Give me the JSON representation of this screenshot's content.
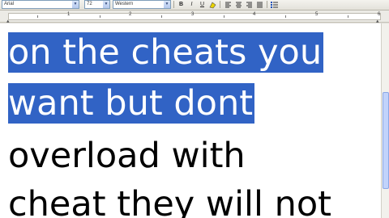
{
  "toolbar": {
    "style": "Arial",
    "size": "72",
    "font": "Western",
    "bold": "B",
    "italic": "I",
    "underline": "U"
  },
  "ruler": {
    "numbers": [
      "1",
      "2",
      "3",
      "4",
      "5",
      "6"
    ]
  },
  "document": {
    "lines": [
      "on the cheats you",
      "want but dont",
      "overload with",
      "cheat they will not"
    ]
  },
  "colors": {
    "selection": "#3163c5",
    "selection_text": "#ffffff"
  }
}
